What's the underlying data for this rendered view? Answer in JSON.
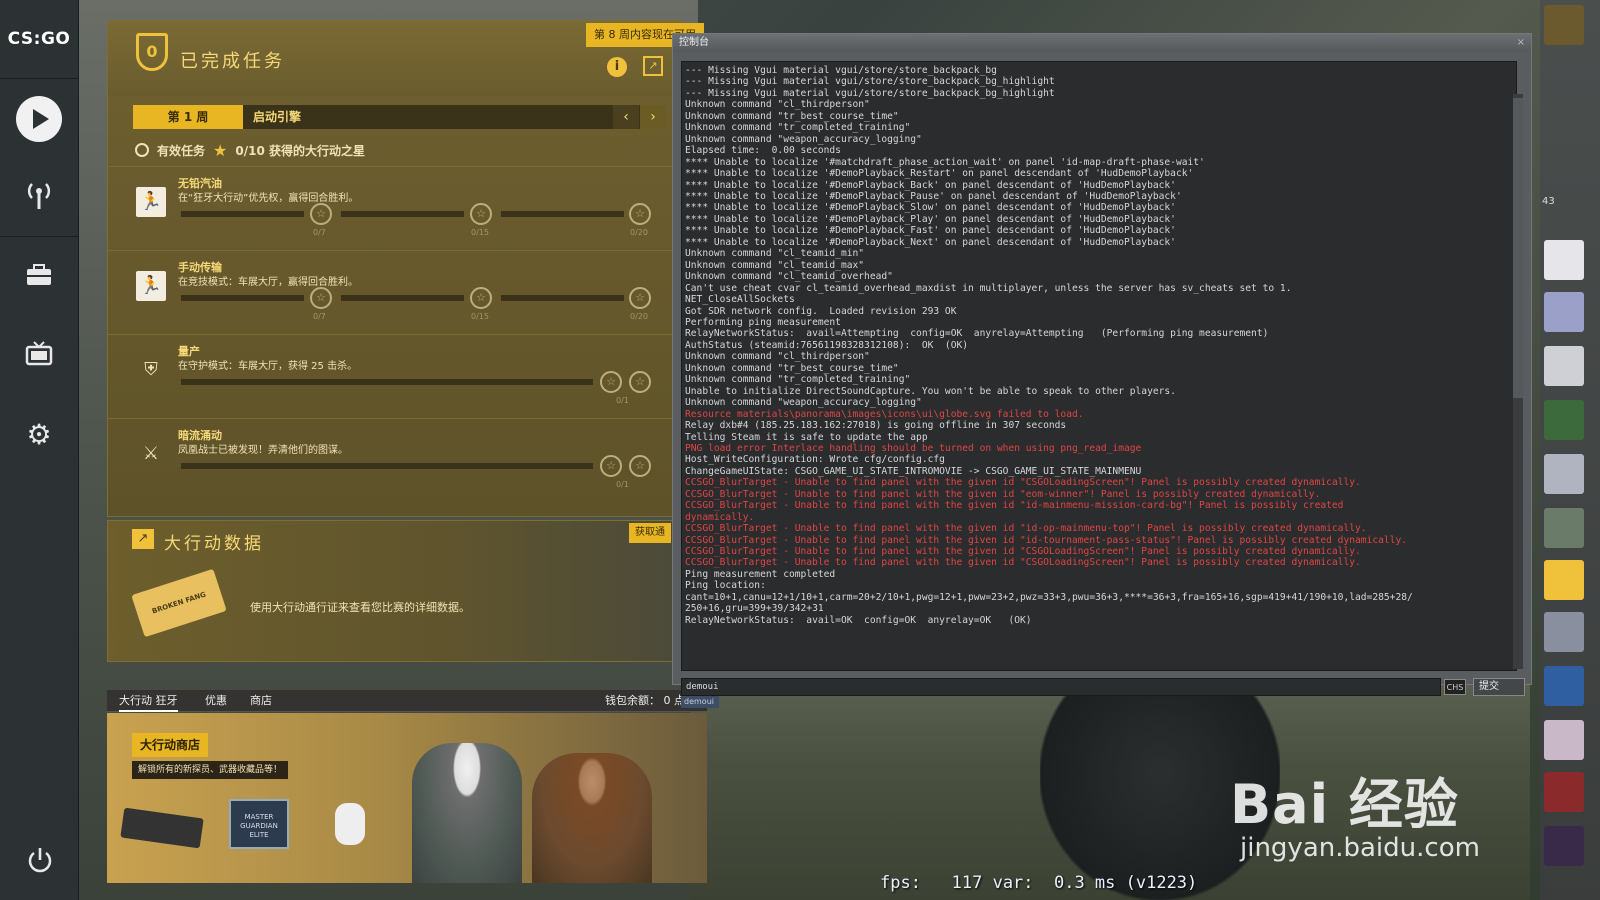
{
  "nav": {
    "logo": "CS:GO",
    "items": [
      {
        "icon": "play-icon"
      },
      {
        "icon": "broadcast-icon"
      },
      {
        "icon": "inventory-icon"
      },
      {
        "icon": "tv-icon"
      },
      {
        "icon": "gear-icon"
      }
    ],
    "power_icon": "power-icon"
  },
  "missions": {
    "badge_number": "0",
    "title": "已完成任务",
    "banner": "第 8 周内容现在可用",
    "info_icon": "i",
    "week_label": "第 1 周",
    "week_name": "启动引擎",
    "active_missions_label": "有效任务",
    "stars_label": "0/10 获得的大行动之星",
    "list": [
      {
        "name": "无铅汽油",
        "desc": "在“狂牙大行动”优先权，赢得回合胜利。",
        "counts": [
          "0/7",
          "0/15",
          "0/20"
        ]
      },
      {
        "name": "手动传输",
        "desc": "在竞技模式：车展大厅，赢得回合胜利。",
        "counts": [
          "0/7",
          "0/15",
          "0/20"
        ]
      },
      {
        "name": "量产",
        "desc": "在守护模式：车展大厅，获得 25 击杀。",
        "counts": [
          "0/1"
        ]
      },
      {
        "name": "暗流涌动",
        "desc": "凤凰战士已被发现！弄清他们的图谋。",
        "counts": [
          "0/1"
        ]
      }
    ]
  },
  "operation_data": {
    "title": "大行动数据",
    "button": "获取通",
    "ticket_text": "BROKEN FANG",
    "desc": "使用大行动通行证来查看您比赛的详细数据。"
  },
  "store": {
    "tabs": [
      "大行动 狂牙",
      "优惠",
      "商店"
    ],
    "wallet": "钱包余额： 0 点",
    "title": "大行动商店",
    "subtitle": "解锁所有的新探员、武器收藏品等！",
    "badge_text": "MASTER GUARDIAN ELITE"
  },
  "console": {
    "title": "控制台",
    "close": "×",
    "input_value": "demoui",
    "suggestion": "demoui",
    "chs": "CHS",
    "submit": "提交",
    "lines": [
      {
        "t": "--- Missing Vgui material vgui/store/store_backpack_bg",
        "err": false
      },
      {
        "t": "--- Missing Vgui material vgui/store/store_backpack_bg_highlight",
        "err": false
      },
      {
        "t": "--- Missing Vgui material vgui/store/store_backpack_bg_highlight",
        "err": false
      },
      {
        "t": "Unknown command \"cl_thirdperson\"",
        "err": false
      },
      {
        "t": "Unknown command \"tr_best_course_time\"",
        "err": false
      },
      {
        "t": "Unknown command \"tr_completed_training\"",
        "err": false
      },
      {
        "t": "Unknown command \"weapon_accuracy_logging\"",
        "err": false
      },
      {
        "t": "Elapsed time:  0.00 seconds",
        "err": false
      },
      {
        "t": "**** Unable to localize '#matchdraft_phase_action_wait' on panel 'id-map-draft-phase-wait'",
        "err": false
      },
      {
        "t": "**** Unable to localize '#DemoPlayback_Restart' on panel descendant of 'HudDemoPlayback'",
        "err": false
      },
      {
        "t": "**** Unable to localize '#DemoPlayback_Back' on panel descendant of 'HudDemoPlayback'",
        "err": false
      },
      {
        "t": "**** Unable to localize '#DemoPlayback_Pause' on panel descendant of 'HudDemoPlayback'",
        "err": false
      },
      {
        "t": "**** Unable to localize '#DemoPlayback_Slow' on panel descendant of 'HudDemoPlayback'",
        "err": false
      },
      {
        "t": "**** Unable to localize '#DemoPlayback_Play' on panel descendant of 'HudDemoPlayback'",
        "err": false
      },
      {
        "t": "**** Unable to localize '#DemoPlayback_Fast' on panel descendant of 'HudDemoPlayback'",
        "err": false
      },
      {
        "t": "**** Unable to localize '#DemoPlayback_Next' on panel descendant of 'HudDemoPlayback'",
        "err": false
      },
      {
        "t": "Unknown command \"cl_teamid_min\"",
        "err": false
      },
      {
        "t": "Unknown command \"cl_teamid_max\"",
        "err": false
      },
      {
        "t": "Unknown command \"cl_teamid_overhead\"",
        "err": false
      },
      {
        "t": "Can't use cheat cvar cl_teamid_overhead_maxdist in multiplayer, unless the server has sv_cheats set to 1.",
        "err": false
      },
      {
        "t": "NET_CloseAllSockets",
        "err": false
      },
      {
        "t": "Got SDR network config.  Loaded revision 293 OK",
        "err": false
      },
      {
        "t": "Performing ping measurement",
        "err": false
      },
      {
        "t": "RelayNetworkStatus:  avail=Attempting  config=OK  anyrelay=Attempting   (Performing ping measurement)",
        "err": false
      },
      {
        "t": "AuthStatus (steamid:76561198328312108):  OK  (OK)",
        "err": false
      },
      {
        "t": "Unknown command \"cl_thirdperson\"",
        "err": false
      },
      {
        "t": "Unknown command \"tr_best_course_time\"",
        "err": false
      },
      {
        "t": "Unknown command \"tr_completed_training\"",
        "err": false
      },
      {
        "t": "Unable to initialize DirectSoundCapture. You won't be able to speak to other players.",
        "err": false
      },
      {
        "t": "Unknown command \"weapon_accuracy_logging\"",
        "err": false
      },
      {
        "t": "Resource materials\\panorama\\images\\icons\\ui\\globe.svg failed to load.",
        "err": true
      },
      {
        "t": "Relay dxb#4 (185.25.183.162:27018) is going offline in 307 seconds",
        "err": false
      },
      {
        "t": "Telling Steam it is safe to update the app",
        "err": false
      },
      {
        "t": "PNG load error Interlace handling should be turned on when using png_read_image",
        "err": true
      },
      {
        "t": "Host_WriteConfiguration: Wrote cfg/config.cfg",
        "err": false
      },
      {
        "t": "ChangeGameUIState: CSGO_GAME_UI_STATE_INTROMOVIE -> CSGO_GAME_UI_STATE_MAINMENU",
        "err": false
      },
      {
        "t": "CCSGO_BlurTarget - Unable to find panel with the given id \"CSGOLoadingScreen\"! Panel is possibly created dynamically.",
        "err": true
      },
      {
        "t": "CCSGO_BlurTarget - Unable to find panel with the given id \"eom-winner\"! Panel is possibly created dynamically.",
        "err": true
      },
      {
        "t": "CCSGO_BlurTarget - Unable to find panel with the given id \"id-mainmenu-mission-card-bg\"! Panel is possibly created",
        "err": true
      },
      {
        "t": "dynamically.",
        "err": true
      },
      {
        "t": "CCSGO_BlurTarget - Unable to find panel with the given id \"id-op-mainmenu-top\"! Panel is possibly created dynamically.",
        "err": true
      },
      {
        "t": "CCSGO_BlurTarget - Unable to find panel with the given id \"id-tournament-pass-status\"! Panel is possibly created dynamically.",
        "err": true
      },
      {
        "t": "CCSGO_BlurTarget - Unable to find panel with the given id \"CSGOLoadingScreen\"! Panel is possibly created dynamically.",
        "err": true
      },
      {
        "t": "CCSGO_BlurTarget - Unable to find panel with the given id \"CSGOLoadingScreen\"! Panel is possibly created dynamically.",
        "err": true
      },
      {
        "t": "Ping measurement completed",
        "err": false
      },
      {
        "t": "Ping location:",
        "err": false
      },
      {
        "t": "cant=10+1,canu=12+1/10+1,carm=20+2/10+1,pwg=12+1,pww=23+2,pwz=33+3,pwu=36+3,****=36+3,fra=165+16,sgp=419+41/190+10,lad=285+28/",
        "err": false
      },
      {
        "t": "250+16,gru=399+39/342+31",
        "err": false
      },
      {
        "t": "RelayNetworkStatus:  avail=OK  config=OK  anyrelay=OK   (OK)",
        "err": false
      }
    ]
  },
  "hud": {
    "fps_text": "fps:   117 var:  0.3 ms (v1223)"
  },
  "watermark": {
    "main": "Bai 经验",
    "sub": "jingyan.baidu.com"
  },
  "friends": {
    "count_partial": "43"
  }
}
